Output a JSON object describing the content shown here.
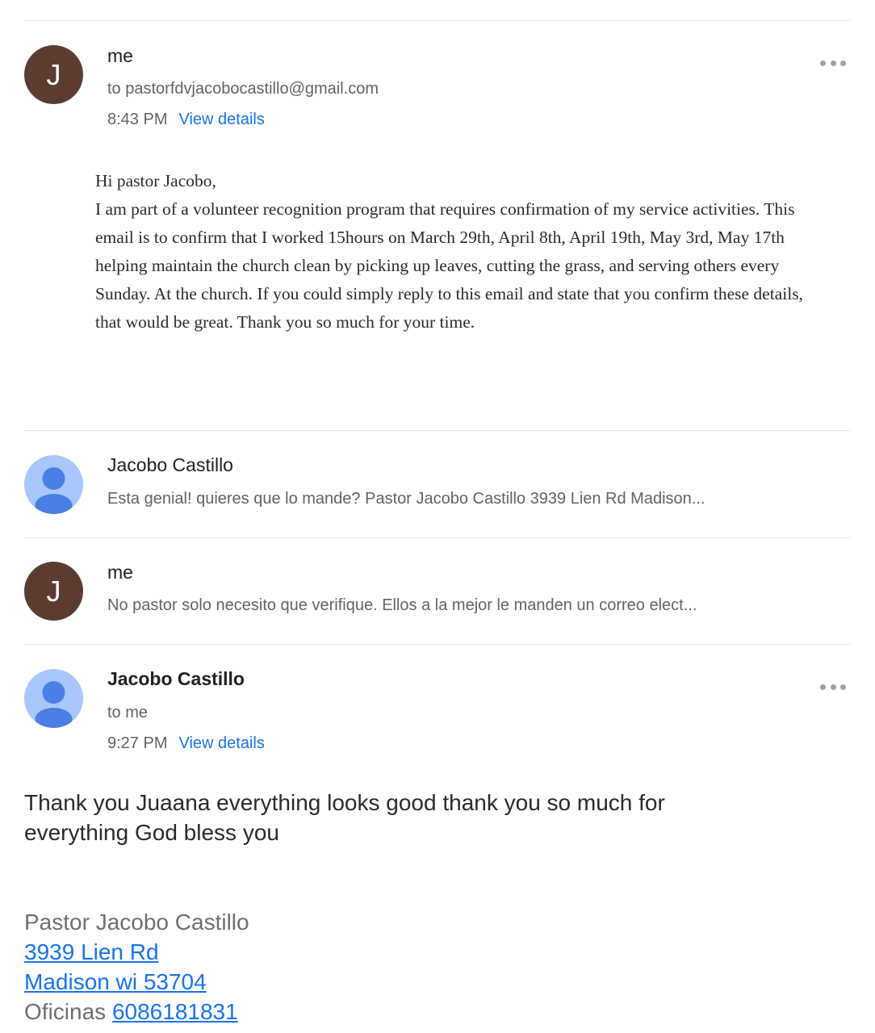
{
  "messages": [
    {
      "sender": "me",
      "avatar_letter": "J",
      "to": "to pastorfdvjacobocastillo@gmail.com",
      "time": "8:43 PM",
      "details_link": "View details",
      "more_icon": "more-horizontal-icon",
      "body": {
        "greeting": "Hi pastor Jacobo,",
        "text": "I am part of a volunteer recognition program that requires confirmation of my service activities. This email is to confirm that I worked 15hours on March 29th, April 8th, April 19th, May 3rd, May 17th helping maintain the church clean by picking up leaves, cutting the grass, and serving others every Sunday. At the church. If you could simply reply to this email and state that you confirm these details, that would be great. Thank you so much for your time."
      }
    },
    {
      "sender": "Jacobo Castillo",
      "avatar_icon": "person-icon",
      "snippet": "Esta genial! quieres que lo mande? Pastor Jacobo Castillo 3939 Lien Rd Madison..."
    },
    {
      "sender": "me",
      "avatar_letter": "J",
      "snippet": "No pastor solo necesito que verifique. Ellos a la mejor le manden un correo elect..."
    },
    {
      "sender": "Jacobo Castillo",
      "avatar_icon": "person-icon",
      "to": "to me",
      "time": "9:27 PM",
      "details_link": "View details",
      "more_icon": "more-horizontal-icon",
      "body": "Thank you Juaana everything looks good thank you so much for everything God bless you",
      "signature": {
        "name": "Pastor Jacobo Castillo",
        "address_line1": "3939 Lien Rd",
        "address_line2": "Madison wi 53704",
        "office_label": "Oficinas",
        "phone": "6086181831"
      }
    }
  ],
  "colors": {
    "avatar_me": "#5b3c33",
    "avatar_default": "#a8c7fa",
    "avatar_person": "#4a7fe6",
    "link": "#1a73e8"
  }
}
